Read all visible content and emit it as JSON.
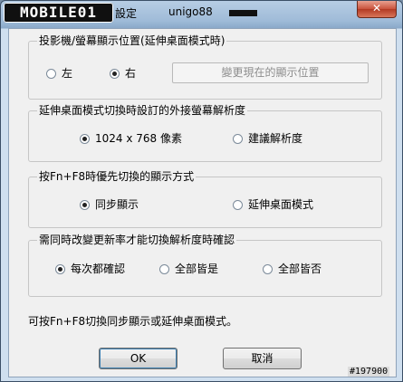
{
  "window": {
    "logo": "MOBILE01",
    "title_app": "設定",
    "title_user": "unigo88",
    "close": "✕"
  },
  "group_position": {
    "title": "投影機/螢幕顯示位置(延伸桌面模式時)",
    "options": [
      {
        "label": "左",
        "selected": false
      },
      {
        "label": "右",
        "selected": true
      }
    ],
    "button": "變更現在的顯示位置"
  },
  "group_resolution": {
    "title": "延伸桌面模式切換時設訂的外接螢幕解析度",
    "options": [
      {
        "label": "1024 x 768 像素",
        "selected": true
      },
      {
        "label": "建議解析度",
        "selected": false
      }
    ]
  },
  "group_fnf8": {
    "title": "按Fn+F8時優先切換的顯示方式",
    "options": [
      {
        "label": "同步顯示",
        "selected": true
      },
      {
        "label": "延伸桌面模式",
        "selected": false
      }
    ]
  },
  "group_confirm": {
    "title": "需同時改變更新率才能切換解析度時確認",
    "options": [
      {
        "label": "每次都確認",
        "selected": true
      },
      {
        "label": "全部皆是",
        "selected": false
      },
      {
        "label": "全部皆否",
        "selected": false
      }
    ]
  },
  "note": "可按Fn+F8切換同步顯示或延伸桌面模式。",
  "buttons": {
    "ok": "OK",
    "cancel": "取消"
  },
  "watermark": "#197900"
}
